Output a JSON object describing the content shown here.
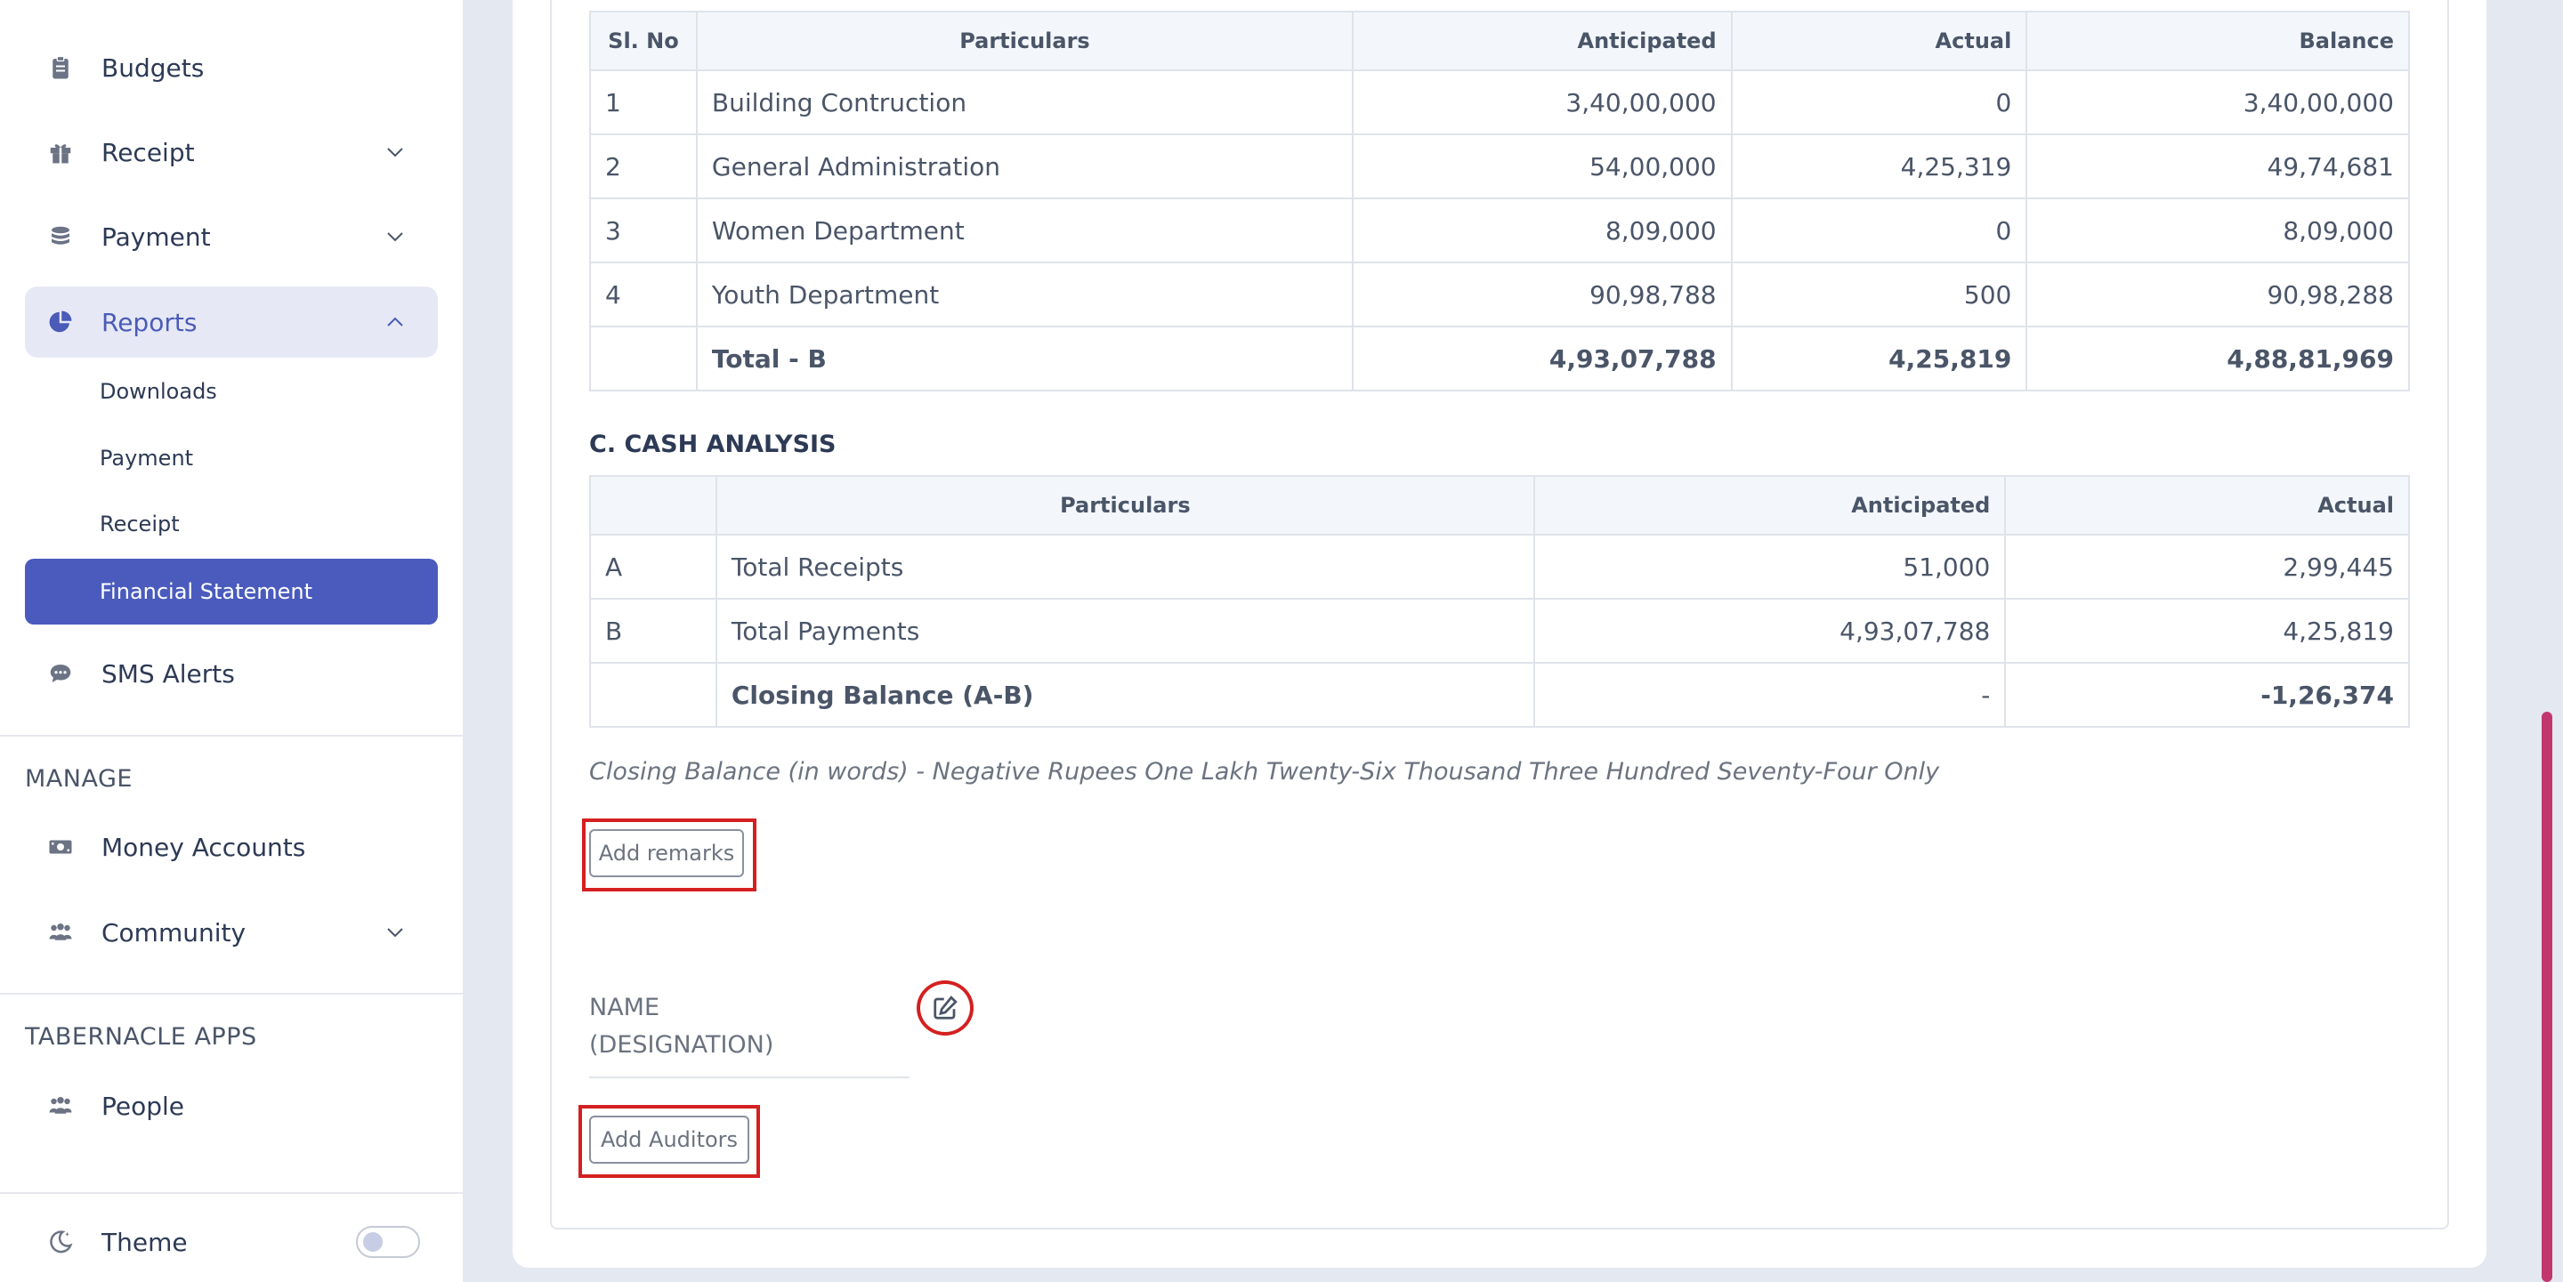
{
  "sidebar": {
    "budgets": "Budgets",
    "receipt": "Receipt",
    "payment": "Payment",
    "reports": "Reports",
    "reports_sub": [
      "Downloads",
      "Payment",
      "Receipt",
      "Financial Statement"
    ],
    "sms_alerts": "SMS Alerts",
    "manage_heading": "MANAGE",
    "money_accounts": "Money Accounts",
    "community": "Community",
    "apps_heading": "TABERNACLE APPS",
    "people": "People",
    "theme": "Theme"
  },
  "table_b": {
    "headers": [
      "Sl. No",
      "Particulars",
      "Anticipated",
      "Actual",
      "Balance"
    ],
    "rows": [
      [
        "1",
        "Building Contruction",
        "3,40,00,000",
        "0",
        "3,40,00,000"
      ],
      [
        "2",
        "General Administration",
        "54,00,000",
        "4,25,319",
        "49,74,681"
      ],
      [
        "3",
        "Women Department",
        "8,09,000",
        "0",
        "8,09,000"
      ],
      [
        "4",
        "Youth Department",
        "90,98,788",
        "500",
        "90,98,288"
      ]
    ],
    "total": [
      "",
      "Total - B",
      "4,93,07,788",
      "4,25,819",
      "4,88,81,969"
    ]
  },
  "cash_analysis": {
    "title": "C. CASH ANALYSIS",
    "headers": [
      "",
      "Particulars",
      "Anticipated",
      "Actual"
    ],
    "rows": [
      [
        "A",
        "Total Receipts",
        "51,000",
        "2,99,445"
      ],
      [
        "B",
        "Total Payments",
        "4,93,07,788",
        "4,25,819"
      ],
      [
        "",
        "Closing Balance (A-B)",
        "-",
        "-1,26,374"
      ]
    ],
    "in_words": "Closing Balance (in words) - Negative Rupees One Lakh Twenty-Six Thousand Three Hundred Seventy-Four Only"
  },
  "remarks_button": "Add remarks",
  "signatory": {
    "name": "NAME",
    "designation": "(DESIGNATION)"
  },
  "auditors_button": "Add Auditors",
  "colors": {
    "accent": "#4a5bbd",
    "highlight": "#d42020",
    "scrollbar": "#c2366e"
  }
}
